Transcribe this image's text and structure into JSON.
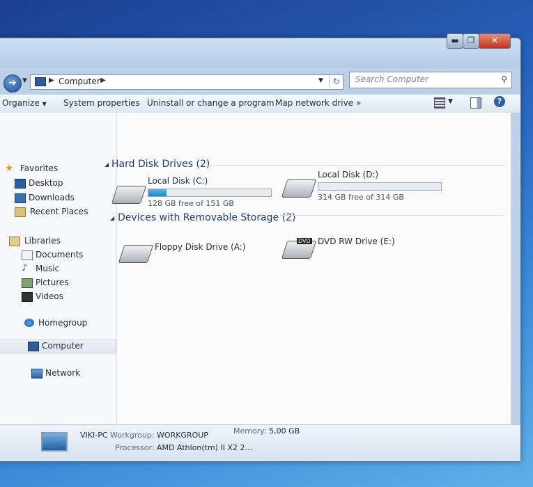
{
  "window": {
    "min_label": "▬",
    "max_label": "❐",
    "close_label": "✕"
  },
  "address": {
    "path": "Computer",
    "search_placeholder": "Search Computer"
  },
  "toolbar": {
    "organize": "Organize",
    "system_properties": "System properties",
    "uninstall": "Uninstall or change a program",
    "map_drive": "Map network drive",
    "more": "»"
  },
  "nav": {
    "favorites": "Favorites",
    "desktop": "Desktop",
    "downloads": "Downloads",
    "recent": "Recent Places",
    "libraries": "Libraries",
    "documents": "Documents",
    "music": "Music",
    "pictures": "Pictures",
    "videos": "Videos",
    "homegroup": "Homegroup",
    "computer": "Computer",
    "network": "Network"
  },
  "groups": {
    "hdd_title": "Hard Disk Drives (2)",
    "removable_title": "Devices with Removable Storage (2)"
  },
  "drives": {
    "c": {
      "name": "Local Disk (C:)",
      "free": "128 GB free of 151 GB",
      "used_fraction": 0.15
    },
    "d": {
      "name": "Local Disk (D:)",
      "free": "314 GB free of 314 GB",
      "used_fraction": 0.0
    },
    "a": {
      "name": "Floppy Disk Drive (A:)"
    },
    "e": {
      "name": "DVD RW Drive (E:)",
      "badge": "DVD"
    }
  },
  "details": {
    "pc": "VIKI-PC",
    "workgroup_label": "Workgroup:",
    "workgroup": "WORKGROUP",
    "memory_label": "Memory:",
    "memory": "5,00 GB",
    "processor_label": "Processor:",
    "processor": "AMD Athlon(tm) II X2 2..."
  }
}
